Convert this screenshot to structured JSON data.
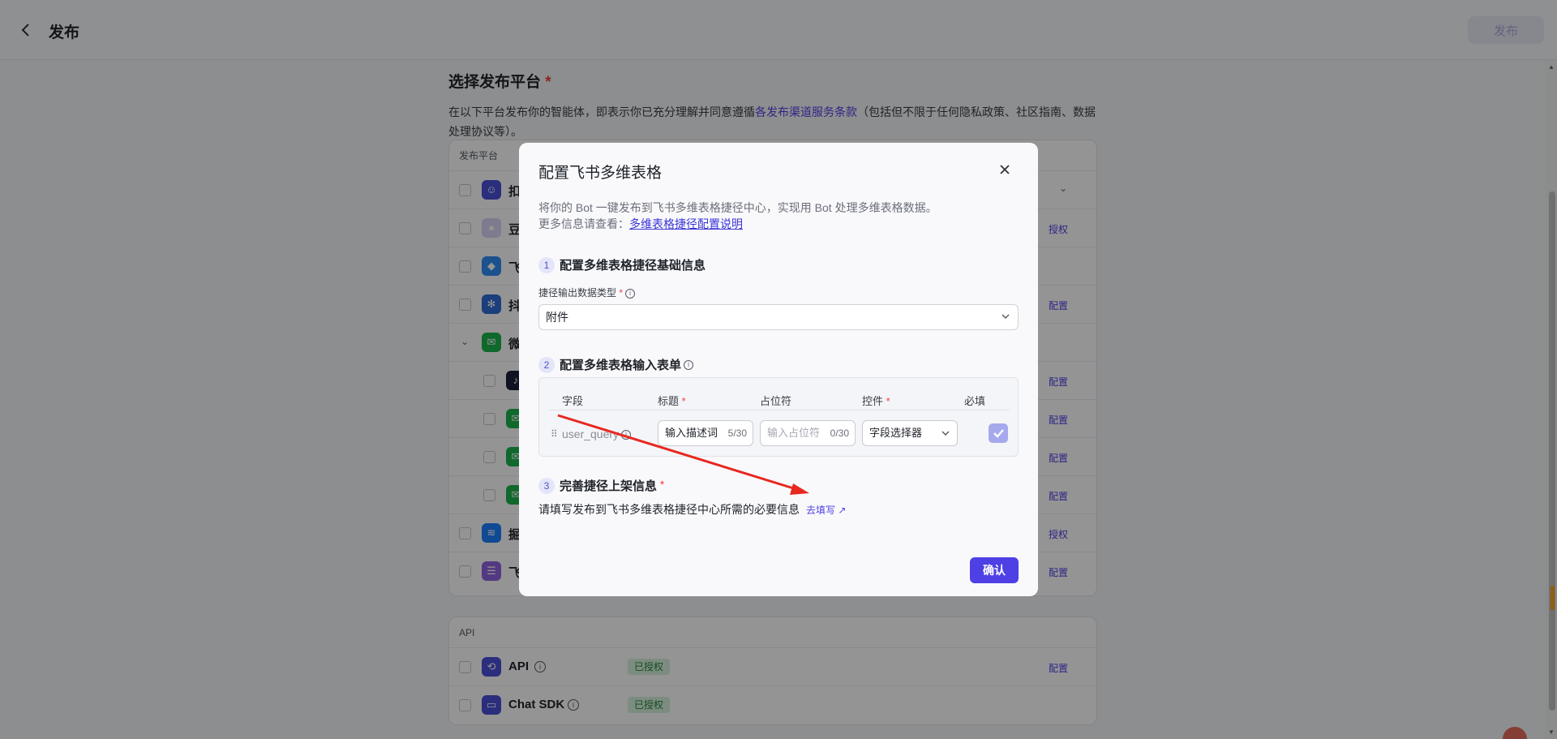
{
  "header": {
    "title": "发布",
    "publish_label": "发布"
  },
  "section": {
    "title": "选择发布平台",
    "required_mark": "*",
    "desc_prefix": "在以下平台发布你的智能体，即表示你已充分理解并同意遵循",
    "desc_link": "各发布渠道服务条款",
    "desc_suffix": "（包括但不限于任何隐私政策、社区指南、数据处理协议等）。"
  },
  "platform_card": {
    "header": "发布平台",
    "rows": [
      {
        "name": "扣",
        "icon": "bot-icon",
        "color": "#4b4fd8",
        "action": ""
      },
      {
        "name": "豆",
        "icon": "doubao-icon",
        "color": "#d9d4f5",
        "action": "授权"
      },
      {
        "name": "飞",
        "icon": "feishu-icon",
        "color": "#2f8cf5",
        "action": ""
      },
      {
        "name": "抖",
        "icon": "asterisk-icon",
        "color": "#2f6bd6",
        "action": "配置"
      },
      {
        "name": "微",
        "icon": "wechat-icon",
        "color": "#1ab34d",
        "action": ""
      },
      {
        "name": "",
        "icon": "tiktok-icon",
        "color": "#1c1f3a",
        "action": "配置"
      },
      {
        "name": "",
        "icon": "wechat-icon",
        "color": "#1ab34d",
        "action": "配置"
      },
      {
        "name": "",
        "icon": "wechat-icon",
        "color": "#1ab34d",
        "action": "配置"
      },
      {
        "name": "",
        "icon": "wechat-icon",
        "color": "#1ab34d",
        "action": "配置"
      },
      {
        "name": "掘",
        "icon": "juejin-icon",
        "color": "#1e80ff",
        "action": "授权"
      },
      {
        "name": "飞",
        "icon": "list-icon",
        "color": "#8f63e0",
        "action": "配置"
      }
    ]
  },
  "api_card": {
    "header": "API",
    "rows": [
      {
        "name": "API",
        "badge": "已授权",
        "action": "配置",
        "icon": "link-icon"
      },
      {
        "name": "Chat SDK",
        "badge": "已授权",
        "action": "",
        "icon": "window-icon"
      }
    ]
  },
  "modal": {
    "title": "配置飞书多维表格",
    "desc_line1": "将你的 Bot 一键发布到飞书多维表格捷径中心，实现用 Bot 处理多维表格数据。",
    "desc_line2_prefix": "更多信息请查看：",
    "desc_link": "多维表格捷径配置说明",
    "step1": {
      "num": "1",
      "title": "配置多维表格捷径基础信息"
    },
    "field_label": "捷径输出数据类型",
    "required_mark": "*",
    "select_value": "附件",
    "step2": {
      "num": "2",
      "title": "配置多维表格输入表单"
    },
    "table": {
      "headers": {
        "field": "字段",
        "title": "标题",
        "placeholder": "占位符",
        "control": "控件",
        "required": "必填"
      },
      "row": {
        "field": "user_query",
        "title_value": "输入描述词",
        "title_count": "5/30",
        "placeholder_hint": "输入占位符",
        "placeholder_count": "0/30",
        "control": "字段选择器"
      }
    },
    "step3": {
      "num": "3",
      "title": "完善捷径上架信息"
    },
    "step3_desc": "请填写发布到飞书多维表格捷径中心所需的必要信息",
    "step3_link": "去填写 ↗",
    "confirm_label": "确认"
  },
  "colors": {
    "accent": "#4e40e5",
    "annotation_arrow": "#e8271f"
  }
}
